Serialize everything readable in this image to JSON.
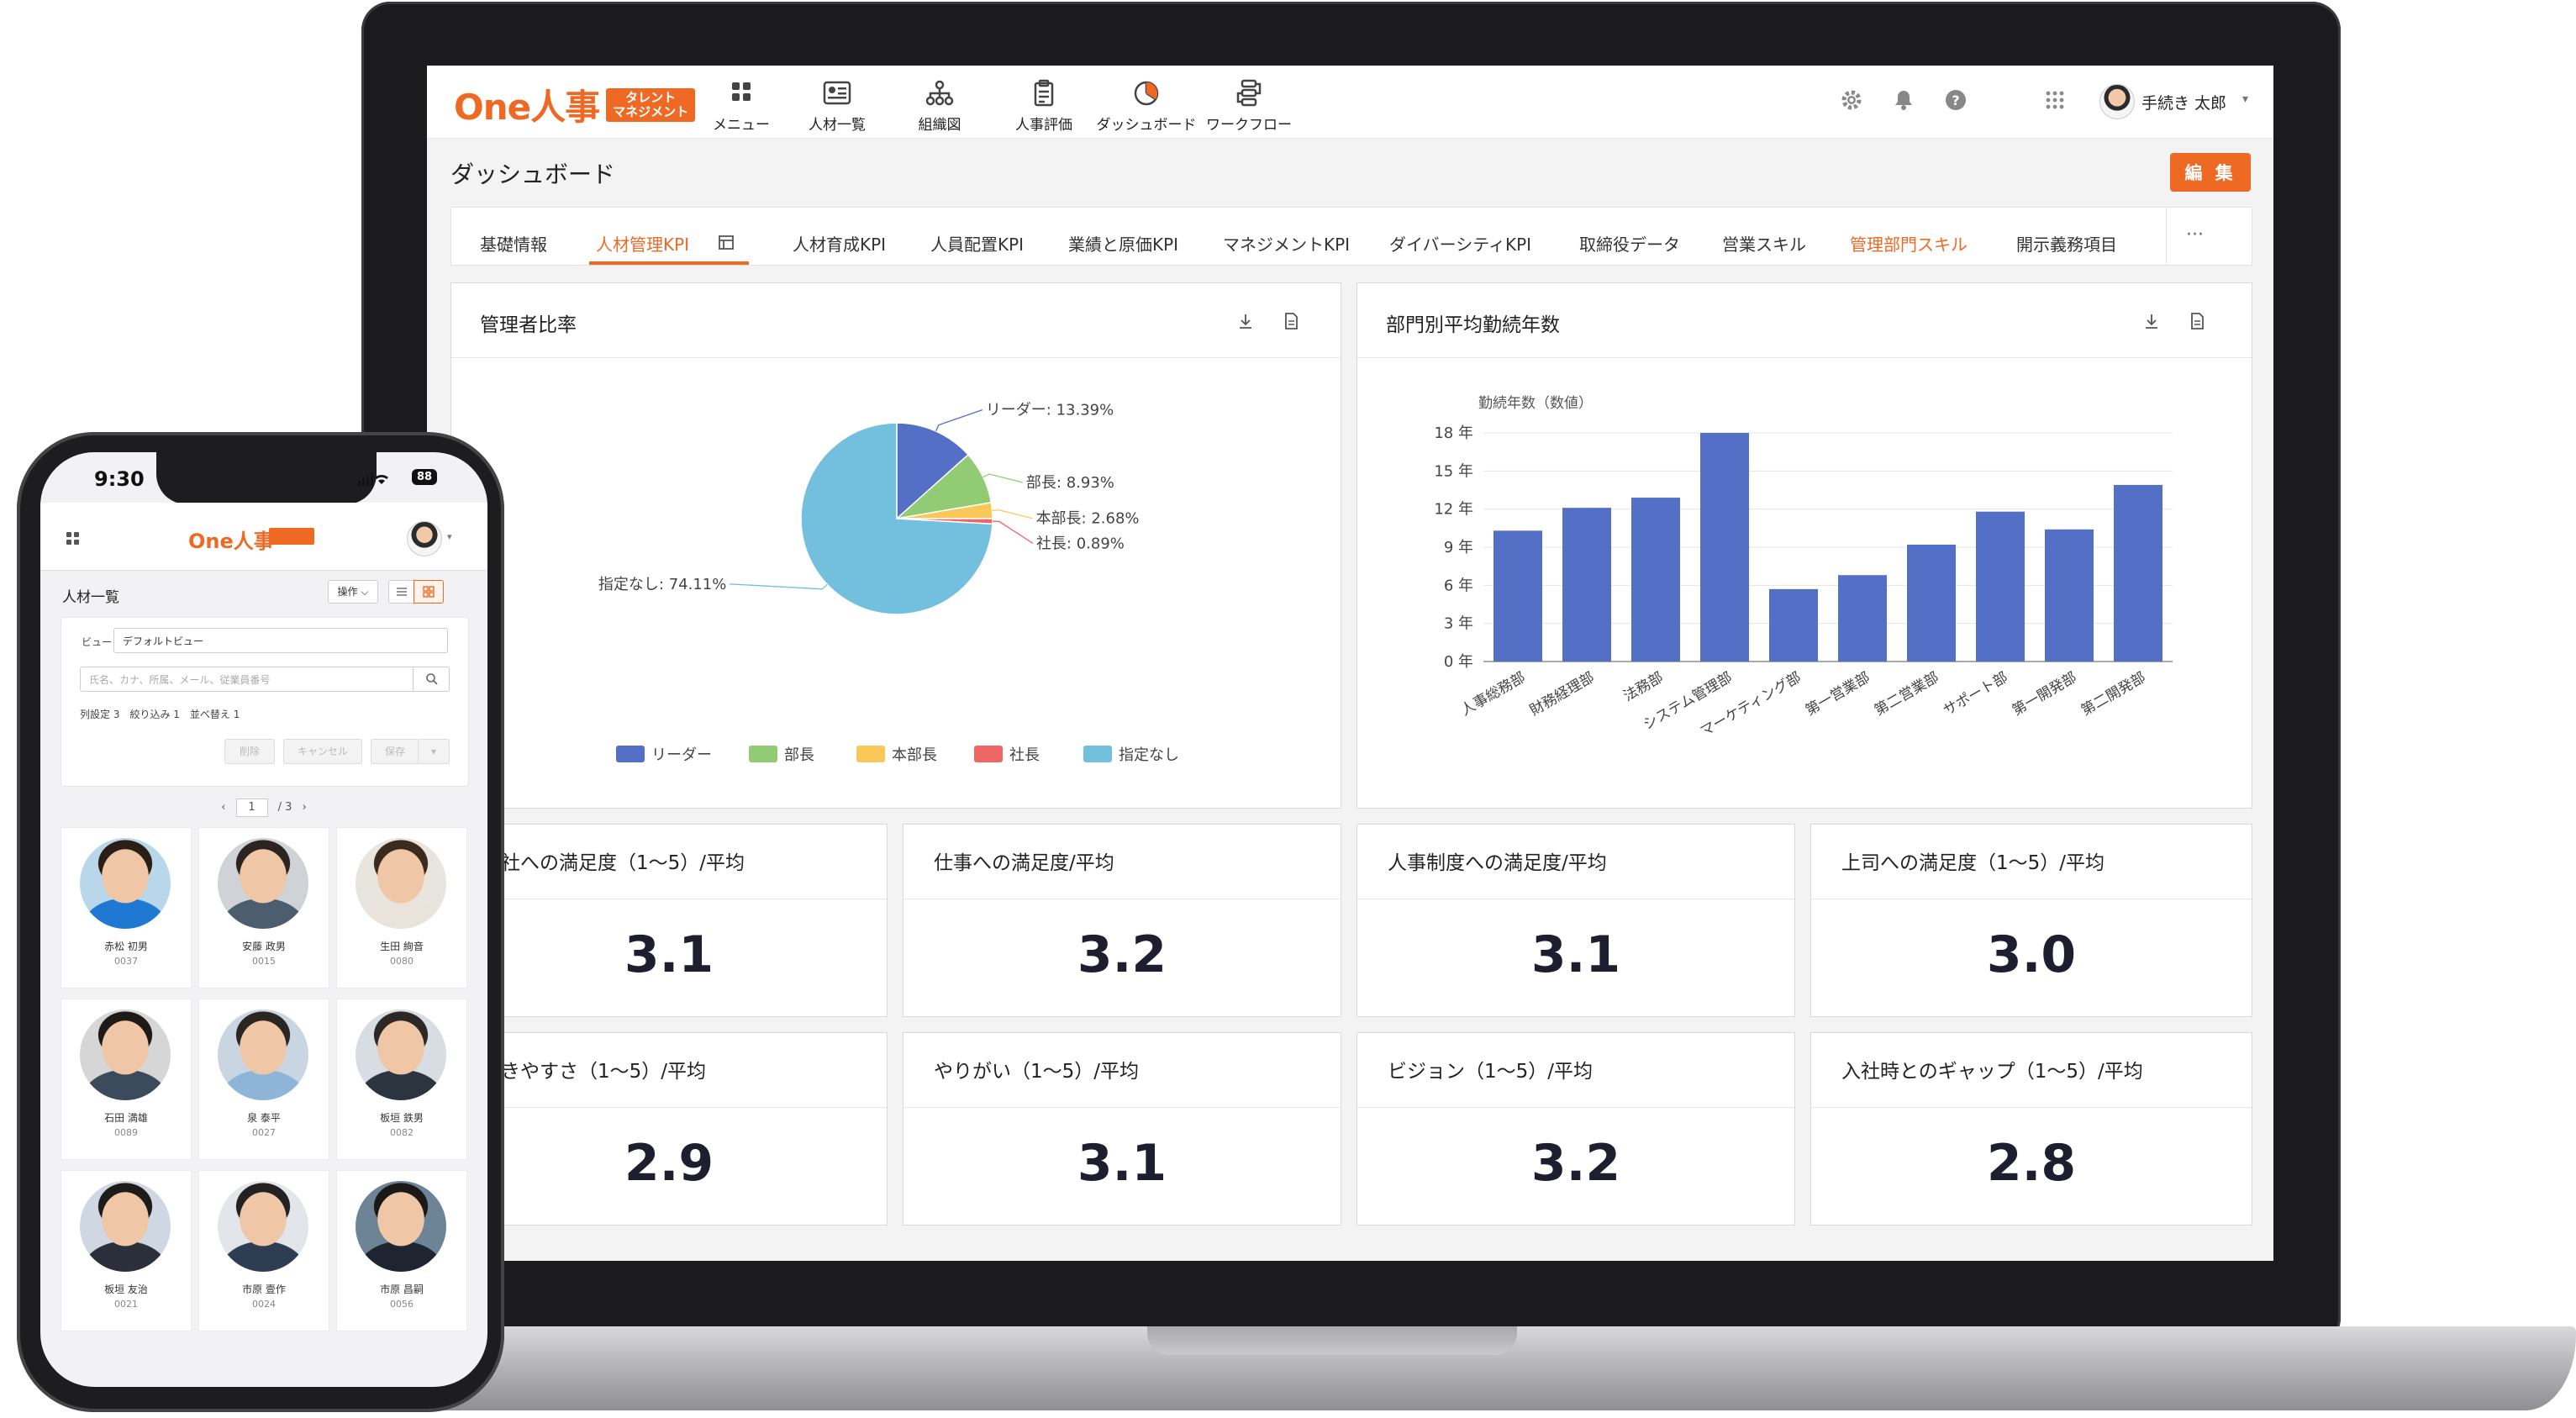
{
  "header": {
    "logo_text": "One人事",
    "logo_badge_line1": "タレント",
    "logo_badge_line2": "マネジメント",
    "nav": [
      {
        "label": "メニュー",
        "icon": "grid-icon"
      },
      {
        "label": "人材一覧",
        "icon": "id-card-icon"
      },
      {
        "label": "組織図",
        "icon": "org-chart-icon"
      },
      {
        "label": "人事評価",
        "icon": "clipboard-icon"
      },
      {
        "label": "ダッシュボード",
        "icon": "pie-chart-icon"
      },
      {
        "label": "ワークフロー",
        "icon": "workflow-icon"
      }
    ],
    "user_name": "手続き 太郎"
  },
  "page": {
    "title": "ダッシュボード",
    "edit_label": "編 集"
  },
  "tabs": [
    {
      "label": "基礎情報"
    },
    {
      "label": "人材管理KPI"
    },
    {
      "label": "人材育成KPI"
    },
    {
      "label": "人員配置KPI"
    },
    {
      "label": "業績と原価KPI"
    },
    {
      "label": "マネジメントKPI"
    },
    {
      "label": "ダイバーシティKPI"
    },
    {
      "label": "取締役データ"
    },
    {
      "label": "営業スキル"
    },
    {
      "label": "管理部門スキル"
    },
    {
      "label": "開示義務項目"
    }
  ],
  "tab_more": "···",
  "pie_panel": {
    "title": "管理者比率"
  },
  "bar_panel": {
    "title": "部門別平均勤続年数"
  },
  "chart_data": [
    {
      "type": "pie",
      "categories": [
        "リーダー",
        "部長",
        "本部長",
        "社長",
        "指定なし"
      ],
      "values": [
        13.39,
        8.93,
        2.68,
        0.89,
        74.11
      ],
      "value_labels": [
        "リーダー: 13.39%",
        "部長: 8.93%",
        "本部長: 2.68%",
        "社長: 0.89%",
        "指定なし: 74.11%"
      ],
      "colors": [
        "#5470c6",
        "#91cc75",
        "#fac858",
        "#ee6666",
        "#73c0de"
      ],
      "legend_position": "bottom",
      "title": "管理者比率"
    },
    {
      "type": "bar",
      "title": "部門別平均勤続年数",
      "ylabel": "勤続年数（数値）",
      "categories": [
        "人事総務部",
        "財務経理部",
        "法務部",
        "システム管理部",
        "マーケティング部",
        "第一営業部",
        "第二営業部",
        "サポート部",
        "第一開発部",
        "第二開発部"
      ],
      "values": [
        10.3,
        12.1,
        12.9,
        18.0,
        5.7,
        6.8,
        9.2,
        11.8,
        10.4,
        13.9
      ],
      "ylim": [
        0,
        18
      ],
      "yticks": [
        "0 年",
        "3 年",
        "6 年",
        "9 年",
        "12 年",
        "15 年",
        "18 年"
      ],
      "color": "#5470c6",
      "grid": true
    }
  ],
  "kpis": [
    {
      "title": "会社への満足度（1〜5）/平均",
      "value": "3.1"
    },
    {
      "title": "仕事への満足度/平均",
      "value": "3.2"
    },
    {
      "title": "人事制度への満足度/平均",
      "value": "3.1"
    },
    {
      "title": "上司への満足度（1〜5）/平均",
      "value": "3.0"
    },
    {
      "title": "働きやすさ（1〜5）/平均",
      "value": "2.9"
    },
    {
      "title": "やりがい（1〜5）/平均",
      "value": "3.1"
    },
    {
      "title": "ビジョン（1〜5）/平均",
      "value": "3.2"
    },
    {
      "title": "入社時とのギャップ（1〜5）/平均",
      "value": "2.8"
    }
  ],
  "phone": {
    "status_time": "9:30",
    "battery": "88",
    "logo_text": "One人事",
    "list_title": "人材一覧",
    "ops_label": "操作 ⌵",
    "view_label": "ビュー",
    "view_value": "デフォルトビュー",
    "search_placeholder": "氏名、カナ、所属、メール、従業員番号",
    "filter_stats": "列設定 3　絞り込み 1　並べ替え 1",
    "buttons": [
      "削除",
      "キャンセル",
      "保存"
    ],
    "pager_current": "1",
    "pager_total": "/ 3",
    "employees": [
      {
        "name": "赤松 初男",
        "id": "0037"
      },
      {
        "name": "安藤 政男",
        "id": "0015"
      },
      {
        "name": "生田 絢音",
        "id": "0080"
      },
      {
        "name": "石田 満雄",
        "id": "0089"
      },
      {
        "name": "泉 泰平",
        "id": "0027"
      },
      {
        "name": "板垣 鉄男",
        "id": "0082"
      },
      {
        "name": "板垣 友治",
        "id": "0021"
      },
      {
        "name": "市原 壹作",
        "id": "0024"
      },
      {
        "name": "市原 昌嗣",
        "id": "0056"
      }
    ]
  }
}
